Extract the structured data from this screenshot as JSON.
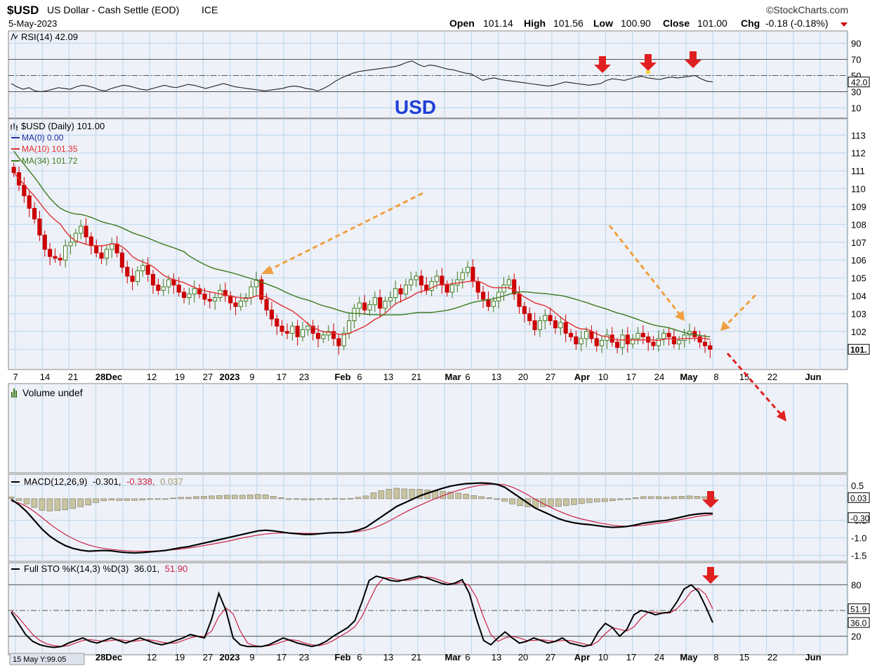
{
  "header": {
    "symbol": "$USD",
    "name": "US Dollar - Cash Settle (EOD)",
    "exchange": "ICE",
    "watermark": "©StockCharts.com",
    "date": "5-May-2023",
    "open_label": "Open",
    "open": "101.14",
    "high_label": "High",
    "high": "101.56",
    "low_label": "Low",
    "low": "100.90",
    "close_label": "Close",
    "close": "101.00",
    "chg_label": "Chg",
    "chg": "-0.18 (-0.18%)"
  },
  "annotation": {
    "text": "USD",
    "color": "#1f3fd6"
  },
  "colors": {
    "up": "#3c7a1e",
    "down": "#cc0000",
    "ma10": "#e03030",
    "ma34": "#3c7a1e",
    "arrow_orange": "#f0a040",
    "arrow_red": "#e02020",
    "grid": "#b8d6ec",
    "panel_bg": "#eef1f8"
  },
  "footer": {
    "crosshair": "15 May Y:99.05"
  },
  "chart_data": [
    {
      "panel": "rsi",
      "type": "line",
      "legend": "RSI(14) 42.09",
      "ylim": [
        0,
        100
      ],
      "yticks": [
        "90",
        "70",
        "50",
        "30",
        "10"
      ],
      "reference_lines": [
        70,
        30,
        50
      ],
      "last_value": "42.0",
      "values": [
        40,
        36,
        33,
        35,
        31,
        30,
        31,
        33,
        35,
        34,
        33,
        36,
        38,
        37,
        35,
        32,
        31,
        34,
        36,
        38,
        37,
        35,
        33,
        32,
        34,
        36,
        38,
        36,
        35,
        37,
        39,
        38,
        36,
        34,
        36,
        38,
        40,
        38,
        36,
        35,
        34,
        33,
        32,
        31,
        32,
        33,
        34,
        36,
        37,
        36,
        34,
        33,
        31,
        34,
        38,
        43,
        47,
        50,
        53,
        55,
        56,
        57,
        58,
        59,
        60,
        61,
        63,
        66,
        68,
        64,
        61,
        63,
        62,
        60,
        58,
        57,
        55,
        53,
        52,
        48,
        44,
        46,
        47,
        45,
        44,
        43,
        42,
        41,
        40,
        39,
        38,
        37,
        38,
        40,
        42,
        41,
        40,
        39,
        38,
        39,
        40,
        44,
        46,
        45,
        44,
        46,
        48,
        49,
        47,
        46,
        45,
        47,
        48,
        47,
        48,
        49,
        50,
        46,
        43,
        42.09
      ]
    },
    {
      "panel": "price",
      "type": "candlestick",
      "title": "$USD (Daily) 101.00",
      "legend": [
        {
          "name": "MA(0) 0.00",
          "color": "#1b2ea8"
        },
        {
          "name": "MA(10) 101.35",
          "color": "#e03030"
        },
        {
          "name": "MA(34) 101.72",
          "color": "#3c7a1e"
        }
      ],
      "ylim": [
        100,
        114
      ],
      "yticks": [
        "113",
        "112",
        "111",
        "110",
        "109",
        "108",
        "107",
        "106",
        "105",
        "104",
        "103",
        "102",
        "101"
      ],
      "last_value_label": "101.",
      "x_axis_labels": [
        "7",
        "14",
        "21",
        "28Dec",
        "12",
        "19",
        "27",
        "2023",
        "9",
        "17",
        "23",
        "Feb",
        "6",
        "13",
        "21",
        "Mar",
        "6",
        "13",
        "20",
        "27",
        "Apr",
        "10",
        "17",
        "24",
        "May",
        "8",
        "15",
        "22",
        "Jun"
      ],
      "close": [
        110.9,
        110.2,
        109.6,
        108.9,
        108.3,
        107.4,
        106.6,
        106.2,
        106.1,
        106.0,
        106.8,
        107.0,
        107.5,
        107.9,
        107.3,
        106.8,
        106.4,
        106.1,
        106.6,
        106.9,
        106.4,
        105.6,
        105.1,
        104.8,
        105.4,
        105.7,
        105.2,
        104.6,
        104.3,
        104.5,
        104.9,
        104.6,
        104.2,
        103.9,
        104.1,
        104.4,
        104.1,
        103.8,
        103.7,
        103.9,
        104.3,
        104.0,
        103.6,
        103.4,
        103.7,
        103.9,
        104.5,
        104.9,
        103.8,
        103.2,
        102.7,
        102.3,
        102.0,
        101.9,
        102.3,
        101.7,
        102.1,
        102.3,
        101.9,
        101.6,
        101.8,
        102.0,
        101.6,
        101.2,
        101.9,
        102.6,
        103.3,
        103.6,
        103.2,
        103.5,
        103.9,
        103.3,
        103.7,
        103.9,
        104.4,
        104.1,
        104.6,
        104.9,
        105.1,
        104.6,
        104.3,
        104.8,
        105.1,
        104.6,
        104.2,
        104.6,
        104.9,
        105.3,
        105.6,
        104.8,
        104.2,
        103.8,
        103.4,
        103.7,
        104.2,
        104.6,
        104.9,
        104.1,
        103.4,
        103.0,
        102.6,
        102.1,
        102.6,
        102.9,
        102.6,
        102.2,
        102.5,
        101.9,
        101.7,
        101.3,
        101.6,
        102.0,
        101.6,
        101.2,
        101.5,
        101.8,
        101.4,
        101.1,
        101.8,
        101.3,
        101.6,
        101.9,
        101.7,
        101.4,
        101.2,
        101.6,
        101.9,
        101.7,
        101.3,
        101.5,
        101.8,
        102.0,
        101.7,
        101.4,
        101.2,
        101.0
      ],
      "ma10_last": 101.35,
      "ma34_last": 101.72
    },
    {
      "panel": "volume",
      "type": "bar",
      "legend": "Volume undef",
      "values": []
    },
    {
      "panel": "macd",
      "type": "line",
      "legend_name": "MACD(12,26,9)",
      "legend_macd": "-0.301,",
      "legend_signal": "-0.338,",
      "legend_hist": "0.037",
      "ylim": [
        -1.7,
        0.7
      ],
      "yticks": [
        "0.5",
        "-0.5",
        "-1.0",
        "-1.5"
      ],
      "last_labels": [
        "0.03",
        "-0.30"
      ],
      "macd": [
        0.1,
        -0.05,
        -0.25,
        -0.5,
        -0.75,
        -0.95,
        -1.1,
        -1.22,
        -1.3,
        -1.35,
        -1.38,
        -1.37,
        -1.36,
        -1.37,
        -1.4,
        -1.42,
        -1.43,
        -1.42,
        -1.4,
        -1.38,
        -1.36,
        -1.32,
        -1.28,
        -1.25,
        -1.2,
        -1.15,
        -1.1,
        -1.05,
        -1.0,
        -0.95,
        -0.9,
        -0.85,
        -0.8,
        -0.78,
        -0.8,
        -0.83,
        -0.86,
        -0.88,
        -0.9,
        -0.9,
        -0.88,
        -0.86,
        -0.85,
        -0.85,
        -0.83,
        -0.78,
        -0.7,
        -0.55,
        -0.4,
        -0.25,
        -0.1,
        0.0,
        0.1,
        0.2,
        0.28,
        0.35,
        0.42,
        0.48,
        0.52,
        0.55,
        0.56,
        0.57,
        0.56,
        0.53,
        0.45,
        0.3,
        0.15,
        0.0,
        -0.15,
        -0.25,
        -0.35,
        -0.45,
        -0.52,
        -0.57,
        -0.6,
        -0.62,
        -0.65,
        -0.68,
        -0.7,
        -0.69,
        -0.67,
        -0.63,
        -0.58,
        -0.55,
        -0.52,
        -0.5,
        -0.45,
        -0.4,
        -0.35,
        -0.32,
        -0.3,
        -0.301
      ],
      "signal": [
        0.05,
        0.0,
        -0.1,
        -0.25,
        -0.42,
        -0.6,
        -0.76,
        -0.9,
        -1.02,
        -1.12,
        -1.2,
        -1.26,
        -1.3,
        -1.33,
        -1.35,
        -1.37,
        -1.38,
        -1.38,
        -1.38,
        -1.37,
        -1.36,
        -1.34,
        -1.32,
        -1.29,
        -1.26,
        -1.22,
        -1.18,
        -1.14,
        -1.1,
        -1.05,
        -1.0,
        -0.96,
        -0.92,
        -0.89,
        -0.87,
        -0.86,
        -0.86,
        -0.86,
        -0.87,
        -0.87,
        -0.87,
        -0.86,
        -0.86,
        -0.85,
        -0.84,
        -0.82,
        -0.78,
        -0.72,
        -0.63,
        -0.52,
        -0.4,
        -0.28,
        -0.17,
        -0.07,
        0.03,
        0.12,
        0.21,
        0.29,
        0.36,
        0.42,
        0.47,
        0.51,
        0.53,
        0.54,
        0.52,
        0.45,
        0.35,
        0.23,
        0.1,
        -0.02,
        -0.13,
        -0.23,
        -0.32,
        -0.4,
        -0.46,
        -0.51,
        -0.56,
        -0.6,
        -0.64,
        -0.66,
        -0.67,
        -0.66,
        -0.64,
        -0.61,
        -0.58,
        -0.55,
        -0.51,
        -0.47,
        -0.43,
        -0.39,
        -0.36,
        -0.338
      ]
    },
    {
      "panel": "stochastic",
      "type": "line",
      "legend_name": "Full STO %K(14,3) %D(3)",
      "legend_k": "36.01,",
      "legend_d": "51.90",
      "ylim": [
        0,
        100
      ],
      "yticks": [
        "80",
        "20"
      ],
      "reference_lines": [
        80,
        20,
        50
      ],
      "last_labels": [
        "51.9",
        "36.0"
      ],
      "k": [
        48,
        35,
        22,
        14,
        10,
        8,
        7,
        8,
        12,
        15,
        18,
        14,
        12,
        15,
        18,
        15,
        12,
        15,
        18,
        15,
        12,
        10,
        12,
        15,
        18,
        22,
        20,
        18,
        40,
        70,
        50,
        18,
        10,
        8,
        8,
        8,
        10,
        14,
        18,
        15,
        12,
        10,
        8,
        10,
        14,
        20,
        25,
        30,
        38,
        60,
        85,
        90,
        88,
        85,
        84,
        86,
        88,
        90,
        88,
        85,
        82,
        80,
        82,
        86,
        70,
        40,
        15,
        10,
        18,
        25,
        18,
        12,
        14,
        18,
        15,
        12,
        14,
        18,
        12,
        10,
        8,
        10,
        25,
        35,
        30,
        20,
        28,
        45,
        50,
        48,
        45,
        47,
        48,
        60,
        75,
        80,
        72,
        55,
        36.01
      ],
      "d": [
        50,
        42,
        32,
        22,
        15,
        11,
        9,
        8,
        9,
        12,
        15,
        16,
        15,
        14,
        15,
        16,
        15,
        14,
        15,
        16,
        15,
        13,
        12,
        12,
        15,
        18,
        20,
        20,
        26,
        43,
        53,
        46,
        26,
        12,
        9,
        8,
        9,
        11,
        14,
        16,
        15,
        12,
        10,
        9,
        11,
        15,
        20,
        25,
        31,
        43,
        61,
        78,
        88,
        88,
        86,
        85,
        86,
        88,
        89,
        88,
        85,
        82,
        81,
        83,
        79,
        65,
        42,
        22,
        14,
        18,
        20,
        18,
        15,
        15,
        16,
        15,
        14,
        15,
        15,
        13,
        11,
        9,
        14,
        23,
        30,
        28,
        26,
        31,
        41,
        48,
        48,
        47,
        47,
        52,
        61,
        72,
        76,
        69,
        51.9
      ]
    }
  ]
}
